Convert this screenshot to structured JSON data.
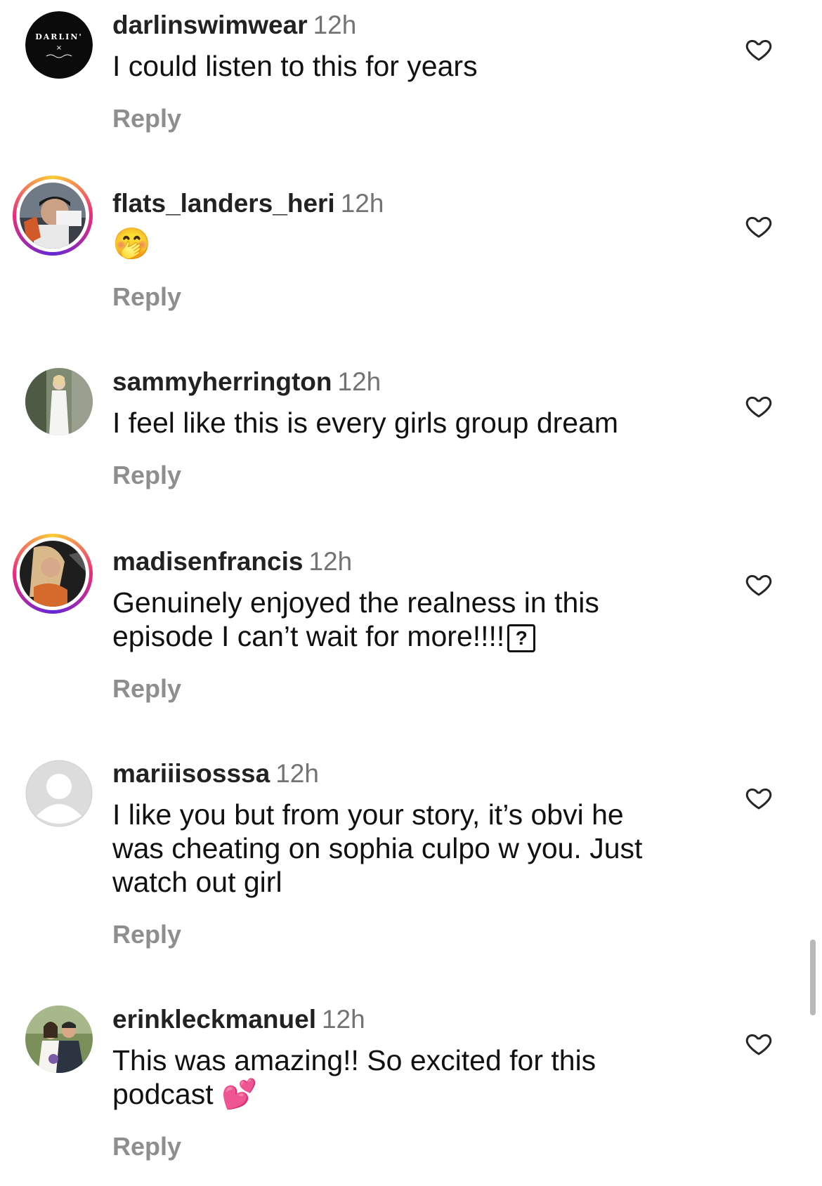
{
  "comments": [
    {
      "username": "darlinswimwear",
      "time": "12h",
      "text": "I could listen to this for years",
      "reply_label": "Reply",
      "avatar_text": "DARLIN'",
      "avatar_sub": "×"
    },
    {
      "username": "flats_landers_heri",
      "time": "12h",
      "text": "🤭",
      "reply_label": "Reply"
    },
    {
      "username": "sammyherrington",
      "time": "12h",
      "text": "I feel like this is every girls group dream",
      "reply_label": "Reply"
    },
    {
      "username": "madisenfrancis",
      "time": "12h",
      "text": "Genuinely enjoyed the realness in this\nepisode I can’t wait for more!!!!",
      "text_symbol": "?",
      "reply_label": "Reply"
    },
    {
      "username": "mariiisosssa",
      "time": "12h",
      "text": "I like you but from your story, it’s obvi he\nwas cheating on sophia culpo w you. Just\nwatch out girl",
      "reply_label": "Reply"
    },
    {
      "username": "erinkleckmanuel",
      "time": "12h",
      "text": "This was amazing!! So excited for this\npodcast 💕",
      "reply_label": "Reply"
    }
  ],
  "icons": {
    "like": "heart-outline-icon",
    "default_avatar": "person-silhouette-icon"
  },
  "colors": {
    "username": "#222222",
    "timestamp": "#737373",
    "reply": "#8e8e8e",
    "story_ring": "#ee2a7b"
  }
}
